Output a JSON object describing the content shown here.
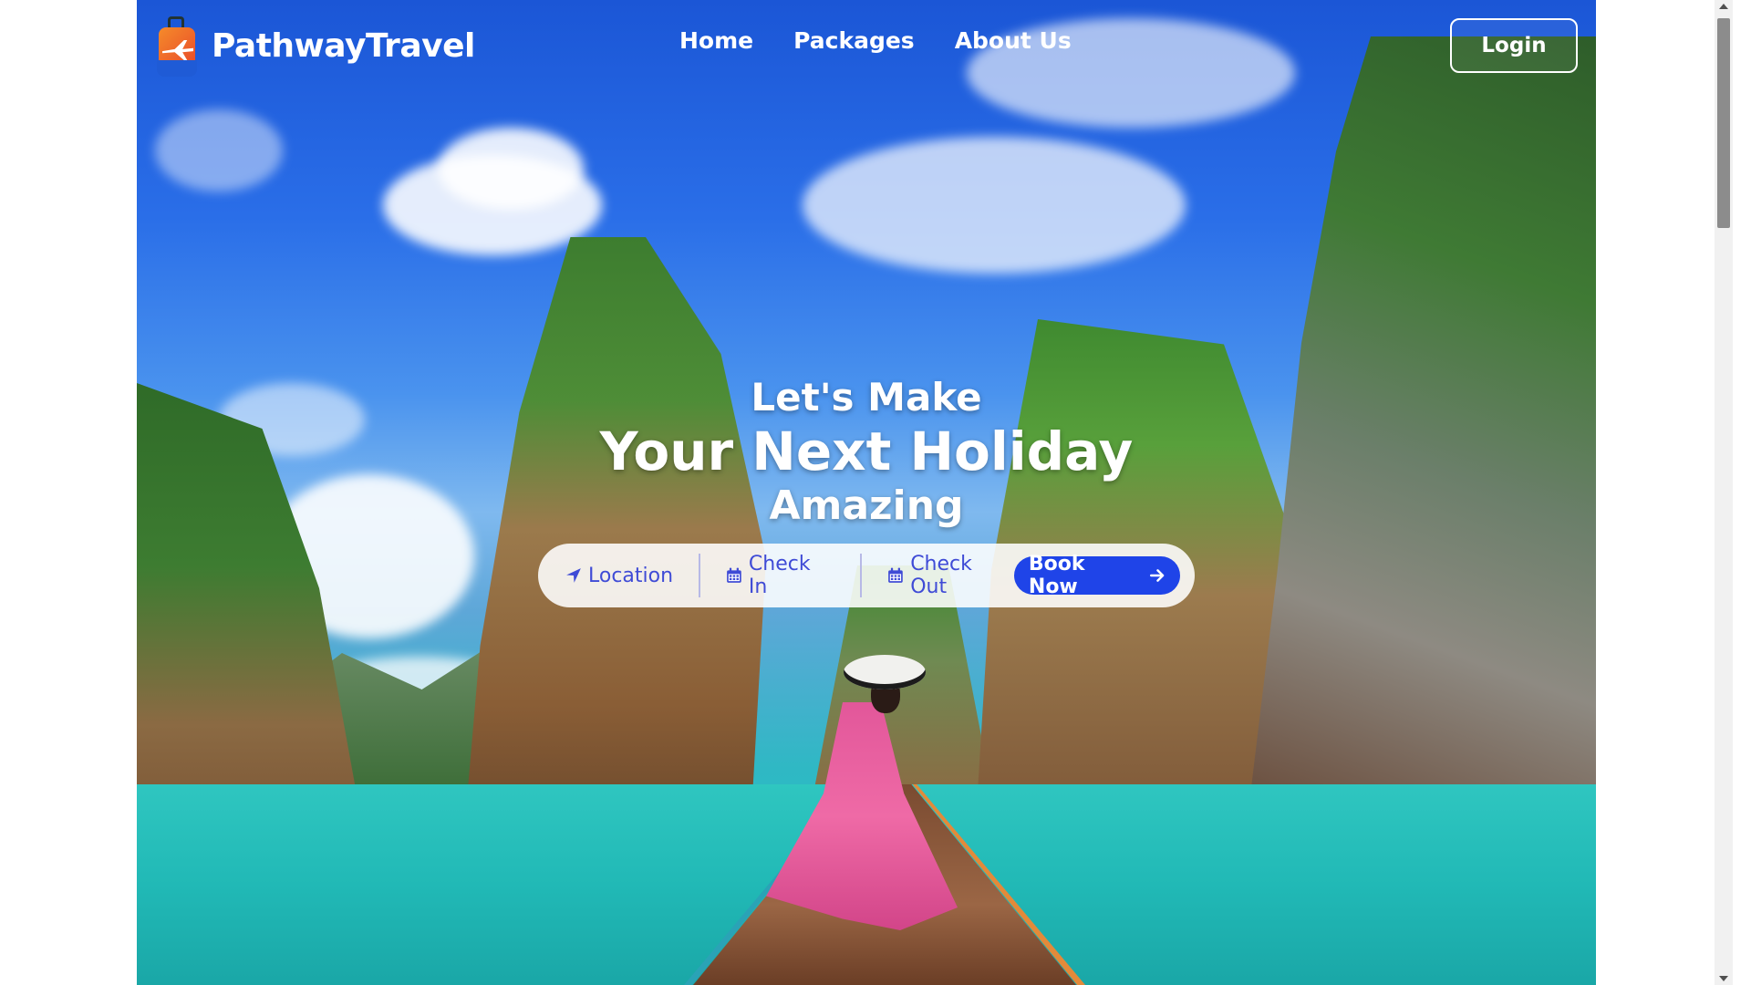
{
  "brand": {
    "name": "PathwayTravel"
  },
  "nav": {
    "items": [
      {
        "label": "Home"
      },
      {
        "label": "Packages"
      },
      {
        "label": "About Us"
      }
    ],
    "login_label": "Login"
  },
  "hero": {
    "line1": "Let's Make",
    "line2": "Your Next Holiday",
    "line3": "Amazing"
  },
  "search": {
    "location_label": "Location",
    "checkin_label": "Check In",
    "checkout_label": "Check Out",
    "book_label": "Book Now",
    "icons": {
      "location": "location-arrow-icon",
      "checkin": "calendar-icon",
      "checkout": "calendar-icon",
      "book": "arrow-right-icon"
    }
  },
  "colors": {
    "accent": "#1f44e8",
    "field_text": "#3f4bd6",
    "brand_orange": "#f58b2a"
  }
}
